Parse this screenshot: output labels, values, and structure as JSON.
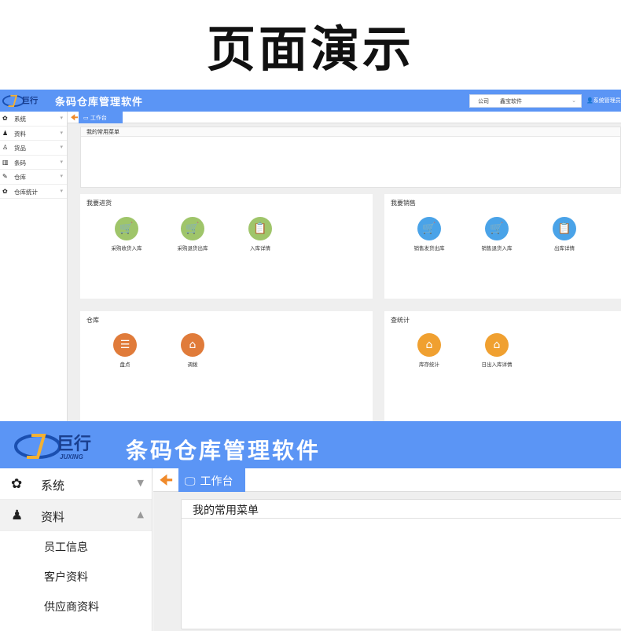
{
  "page": {
    "title": "页面演示"
  },
  "app": {
    "logo_text": "巨行",
    "logo_sub": "JUXING",
    "title": "条码仓库管理软件",
    "brand_color": "#5b95f5",
    "company_label": "公司",
    "company_value": "鑫宝软件",
    "user": "系统管理员"
  },
  "sidebar": {
    "items": [
      {
        "label": "系统",
        "icon": "gear-icon"
      },
      {
        "label": "资料",
        "icon": "user-add-icon"
      },
      {
        "label": "货品",
        "icon": "user-icon"
      },
      {
        "label": "条码",
        "icon": "barcode-icon"
      },
      {
        "label": "仓库",
        "icon": "edit-icon"
      },
      {
        "label": "仓库统计",
        "icon": "gear-icon"
      }
    ],
    "sub_items": [
      "员工信息",
      "客户资料",
      "供应商资料"
    ]
  },
  "tabs": {
    "current": "工作台"
  },
  "favorites": {
    "header": "我的常用菜单"
  },
  "panels": [
    {
      "title": "我要进货",
      "items": [
        {
          "label": "采购收货入库",
          "color": "#9fc56a",
          "icon": "cart-in-icon"
        },
        {
          "label": "采购退货出库",
          "color": "#9fc56a",
          "icon": "cart-out-icon"
        },
        {
          "label": "入库详情",
          "color": "#9fc56a",
          "icon": "clipboard-icon"
        }
      ]
    },
    {
      "title": "我要销售",
      "items": [
        {
          "label": "销售发货出库",
          "color": "#4aa3e8",
          "icon": "cart-out-icon"
        },
        {
          "label": "销售退货入库",
          "color": "#4aa3e8",
          "icon": "cart-in-icon"
        },
        {
          "label": "出库详情",
          "color": "#4aa3e8",
          "icon": "clipboard-icon"
        }
      ]
    },
    {
      "title": "仓库",
      "items": [
        {
          "label": "盘点",
          "color": "#e07b3a",
          "icon": "inventory-search-icon"
        },
        {
          "label": "调拨",
          "color": "#e07b3a",
          "icon": "house-icon"
        }
      ]
    },
    {
      "title": "查统计",
      "items": [
        {
          "label": "库存统计",
          "color": "#f0a030",
          "icon": "house-icon"
        },
        {
          "label": "日出入库详情",
          "color": "#f0a030",
          "icon": "house-icon"
        }
      ]
    }
  ]
}
